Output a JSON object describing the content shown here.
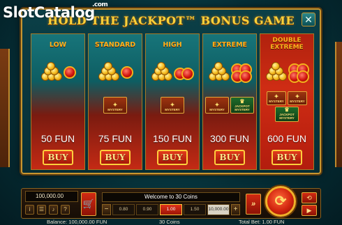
{
  "watermark": {
    "brand_a": "Slot",
    "brand_b": "Catalog",
    "brand_c": ".com"
  },
  "modal": {
    "title": "HOLD THE JACKPOT™ BONUS GAME",
    "close_glyph": "✕"
  },
  "cards": [
    {
      "name": "LOW",
      "price": "50 FUN",
      "buy": "BUY",
      "mystery": []
    },
    {
      "name": "STANDARD",
      "price": "75 FUN",
      "buy": "BUY",
      "mystery": [
        "MYSTERY"
      ]
    },
    {
      "name": "HIGH",
      "price": "150 FUN",
      "buy": "BUY",
      "mystery": [
        "MYSTERY"
      ]
    },
    {
      "name": "EXTREME",
      "price": "300 FUN",
      "buy": "BUY",
      "mystery": [
        "MYSTERY",
        "JACKPOT MYSTERY"
      ]
    },
    {
      "name": "DOUBLE EXTREME",
      "price": "600 FUN",
      "buy": "BUY",
      "mystery": [
        "MYSTERY",
        "MYSTERY",
        "JACKPOT MYSTERY"
      ]
    }
  ],
  "controls": {
    "balance_value": "100,000.00",
    "message": "Welcome to 30 Coins",
    "minus": "−",
    "plus": "+",
    "bets": [
      "0.80",
      "0.90",
      "1.00",
      "1.50",
      "10,000.00"
    ],
    "active_bet_index": 2
  },
  "footer": {
    "balance": "Balance: 100,000.00 FUN",
    "game": "30 Coins",
    "total_bet": "Total Bet: 1.00 FUN"
  },
  "icons": {
    "info": "info-icon",
    "menu": "menu-icon",
    "sound": "sound-icon",
    "help": "help-icon",
    "cart": "cart-icon",
    "turbo": "turbo-icon",
    "spin": "spin-icon",
    "autoplay": "autoplay-icon",
    "play": "play-icon"
  },
  "colors": {
    "gold": "#c9962f",
    "title": "#ffd23a",
    "button_red": "#c42a14",
    "teal": "#0e5d62"
  }
}
